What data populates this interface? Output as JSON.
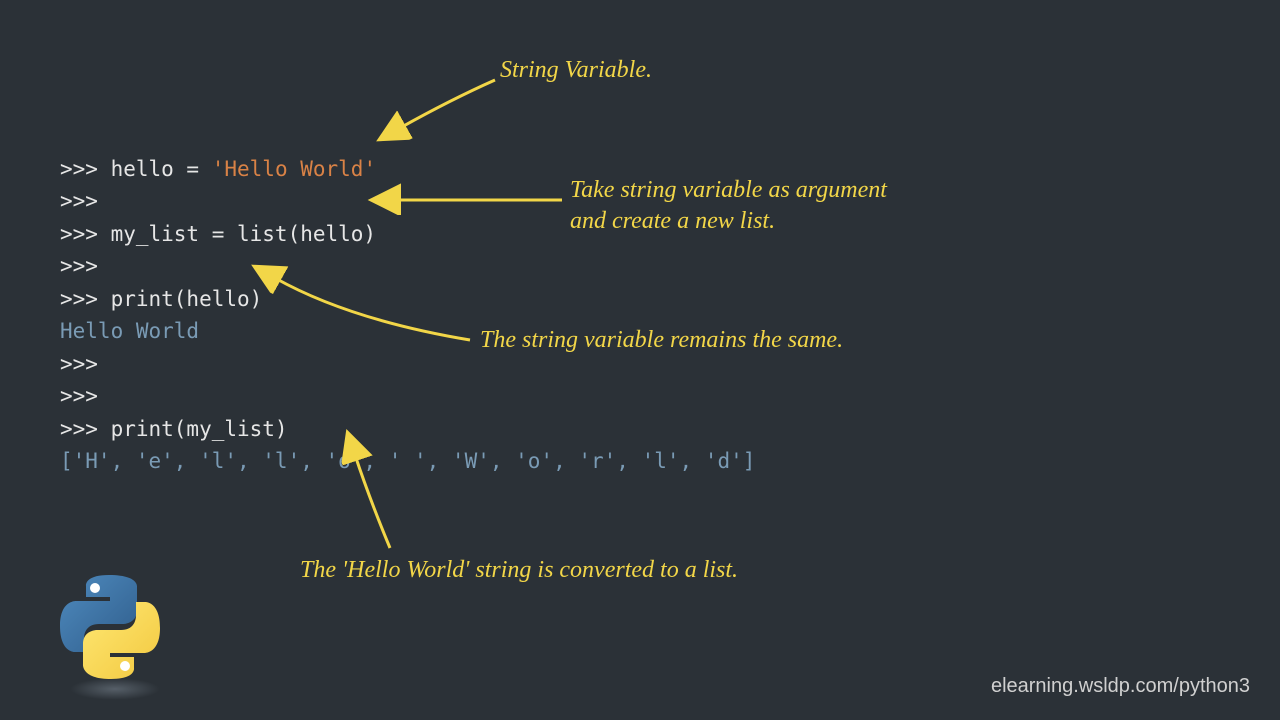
{
  "code": {
    "line1_prompt": ">>> ",
    "line1_a": "hello = ",
    "line1_b": "'Hello World'",
    "line2": ">>>",
    "line3": ">>> my_list = list(hello)",
    "line4": ">>>",
    "line5": ">>> print(hello)",
    "line6": "Hello World",
    "line7": ">>>",
    "line8": ">>>",
    "line9": ">>> print(my_list)",
    "line10": "['H', 'e', 'l', 'l', 'o', ' ', 'W', 'o', 'r', 'l', 'd']"
  },
  "annotations": {
    "a1": "String Variable.",
    "a2_l1": "Take string variable as argument",
    "a2_l2": "and create a new list.",
    "a3": "The string variable remains the same.",
    "a4": "The 'Hello World' string is converted to a list."
  },
  "footer": "elearning.wsldp.com/python3"
}
